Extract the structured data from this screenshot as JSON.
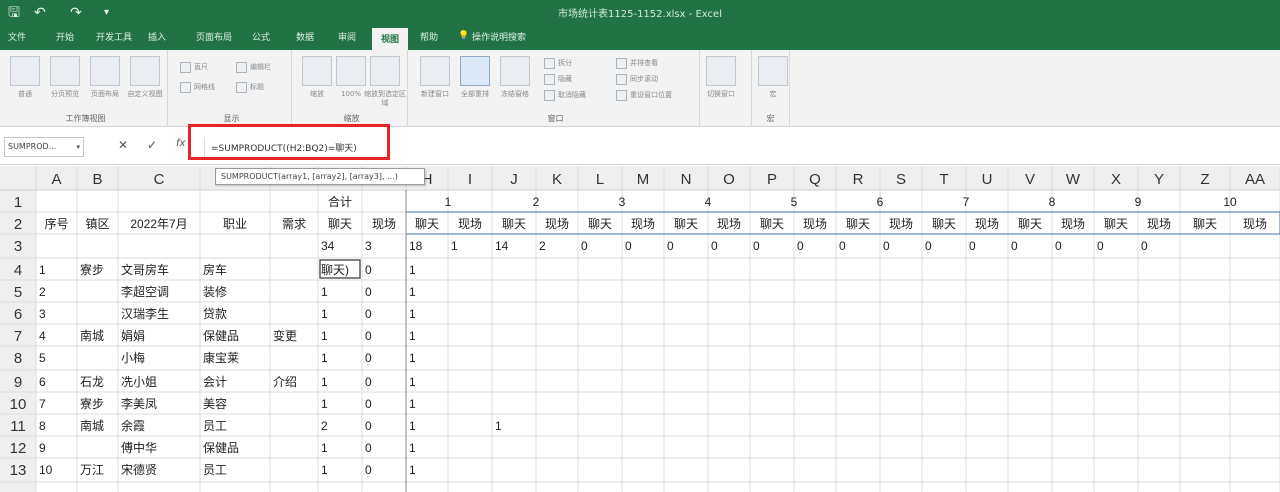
{
  "window": {
    "title": "市场统计表1125-1152.xlsx - Excel"
  },
  "quick_access": {
    "save": "🖫",
    "undo": "↶",
    "redo": "↷",
    "more": "▾"
  },
  "tabs": [
    "文件",
    "开始",
    "开发工具",
    "插入",
    "页面布局",
    "公式",
    "数据",
    "审阅",
    "视图",
    "帮助",
    "操作说明搜索"
  ],
  "active_tab": "视图",
  "ribbon": {
    "groups": [
      {
        "label": "工作簿视图",
        "big": [
          "普通",
          "分页预览",
          "页面布局",
          "自定义视图"
        ]
      },
      {
        "label": "显示",
        "small": [
          "直尺",
          "编辑栏",
          "网格线",
          "标题"
        ]
      },
      {
        "label": "缩放",
        "big": [
          "缩放",
          "100%",
          "缩放到选定区域"
        ]
      },
      {
        "label": "窗口",
        "big": [
          "新建窗口",
          "全部重排",
          "冻结窗格"
        ],
        "small": [
          "拆分",
          "隐藏",
          "取消隐藏",
          "并排查看",
          "同步滚动",
          "重设窗口位置"
        ]
      },
      {
        "label": "",
        "big": [
          "切换窗口"
        ]
      },
      {
        "label": "宏",
        "big": [
          "宏"
        ]
      }
    ],
    "colors": {
      "accent": "#217346",
      "highlight": "#e8232a",
      "header_bg": "#efefef",
      "header_border": "#cfcfcf",
      "frozen_border": "#3c6fb6",
      "selection_border": "#217346"
    }
  },
  "formula_bar": {
    "name_box": "SUMPROD...",
    "cancel_icon": "✕",
    "confirm_icon": "✓",
    "fx_icon": "fx",
    "formula": "=SUMPRODUCT((H2:BQ2)=聊天)"
  },
  "tooltip": "SUMPRODUCT(array1, [array2], [array3], ...)",
  "grid": {
    "col_headers": [
      "A",
      "B",
      "C",
      "D",
      "E",
      "F",
      "G",
      "H",
      "I",
      "J",
      "K",
      "L",
      "M",
      "N",
      "O",
      "P",
      "Q",
      "R",
      "S",
      "T",
      "U",
      "V",
      "W",
      "X",
      "Y",
      "Z",
      "AA"
    ],
    "row_headers": [
      "1",
      "2",
      "3",
      "4",
      "5",
      "6",
      "7",
      "8",
      "9",
      "10",
      "11",
      "12",
      "13"
    ],
    "cells": [
      [
        "",
        "",
        "",
        "",
        "",
        "合计",
        "",
        "1",
        "",
        "2",
        "",
        "3",
        "",
        "4",
        "",
        "5",
        "",
        "6",
        "",
        "7",
        "",
        "8",
        "",
        "9",
        "",
        "10",
        ""
      ],
      [
        "序号",
        "镇区",
        "2022年7月",
        "职业",
        "需求",
        "聊天",
        "现场",
        "聊天",
        "现场",
        "聊天",
        "现场",
        "聊天",
        "现场",
        "聊天",
        "现场",
        "聊天",
        "现场",
        "聊天",
        "现场",
        "聊天",
        "现场",
        "聊天",
        "现场",
        "聊天",
        "现场",
        "聊天",
        "现场"
      ],
      [
        "",
        "",
        "",
        "",
        "",
        "34",
        "3",
        "18",
        "1",
        "14",
        "2",
        "0",
        "0",
        "0",
        "0",
        "0",
        "0",
        "0",
        "0",
        "0",
        "0",
        "0",
        "0",
        "0",
        "0",
        "",
        ""
      ],
      [
        "1",
        "寮步",
        "文哥房车",
        "房车",
        "",
        "聊天)",
        "0",
        "1",
        "",
        "",
        "",
        "",
        "",
        "",
        "",
        "",
        "",
        "",
        "",
        "",
        "",
        "",
        "",
        "",
        "",
        "",
        ""
      ],
      [
        "2",
        "",
        "李超空调",
        "装修",
        "",
        "1",
        "0",
        "1",
        "",
        "",
        "",
        "",
        "",
        "",
        "",
        "",
        "",
        "",
        "",
        "",
        "",
        "",
        "",
        "",
        "",
        "",
        ""
      ],
      [
        "3",
        "",
        "汉瑞李生",
        "贷款",
        "",
        "1",
        "0",
        "1",
        "",
        "",
        "",
        "",
        "",
        "",
        "",
        "",
        "",
        "",
        "",
        "",
        "",
        "",
        "",
        "",
        "",
        "",
        ""
      ],
      [
        "4",
        "南城",
        "娟娟",
        "保健品",
        "变更",
        "1",
        "0",
        "1",
        "",
        "",
        "",
        "",
        "",
        "",
        "",
        "",
        "",
        "",
        "",
        "",
        "",
        "",
        "",
        "",
        "",
        "",
        ""
      ],
      [
        "5",
        "",
        "小梅",
        "康宝莱",
        "",
        "1",
        "0",
        "1",
        "",
        "",
        "",
        "",
        "",
        "",
        "",
        "",
        "",
        "",
        "",
        "",
        "",
        "",
        "",
        "",
        "",
        "",
        ""
      ],
      [
        "6",
        "石龙",
        "冼小姐",
        "会计",
        "介绍",
        "1",
        "0",
        "1",
        "",
        "",
        "",
        "",
        "",
        "",
        "",
        "",
        "",
        "",
        "",
        "",
        "",
        "",
        "",
        "",
        "",
        "",
        ""
      ],
      [
        "7",
        "寮步",
        "李美凤",
        "美容",
        "",
        "1",
        "0",
        "1",
        "",
        "",
        "",
        "",
        "",
        "",
        "",
        "",
        "",
        "",
        "",
        "",
        "",
        "",
        "",
        "",
        "",
        "",
        ""
      ],
      [
        "8",
        "南城",
        "余霞",
        "员工",
        "",
        "2",
        "0",
        "1",
        "",
        "1",
        "",
        "",
        "",
        "",
        "",
        "",
        "",
        "",
        "",
        "",
        "",
        "",
        "",
        "",
        "",
        "",
        ""
      ],
      [
        "9",
        "",
        "傅中华",
        "保健品",
        "",
        "1",
        "0",
        "1",
        "",
        "",
        "",
        "",
        "",
        "",
        "",
        "",
        "",
        "",
        "",
        "",
        "",
        "",
        "",
        "",
        "",
        "",
        ""
      ],
      [
        "10",
        "万江",
        "宋德贤",
        "员工",
        "",
        "1",
        "0",
        "1",
        "",
        "",
        "",
        "",
        "",
        "",
        "",
        "",
        "",
        "",
        "",
        "",
        "",
        "",
        "",
        "",
        "",
        "",
        ""
      ]
    ]
  }
}
